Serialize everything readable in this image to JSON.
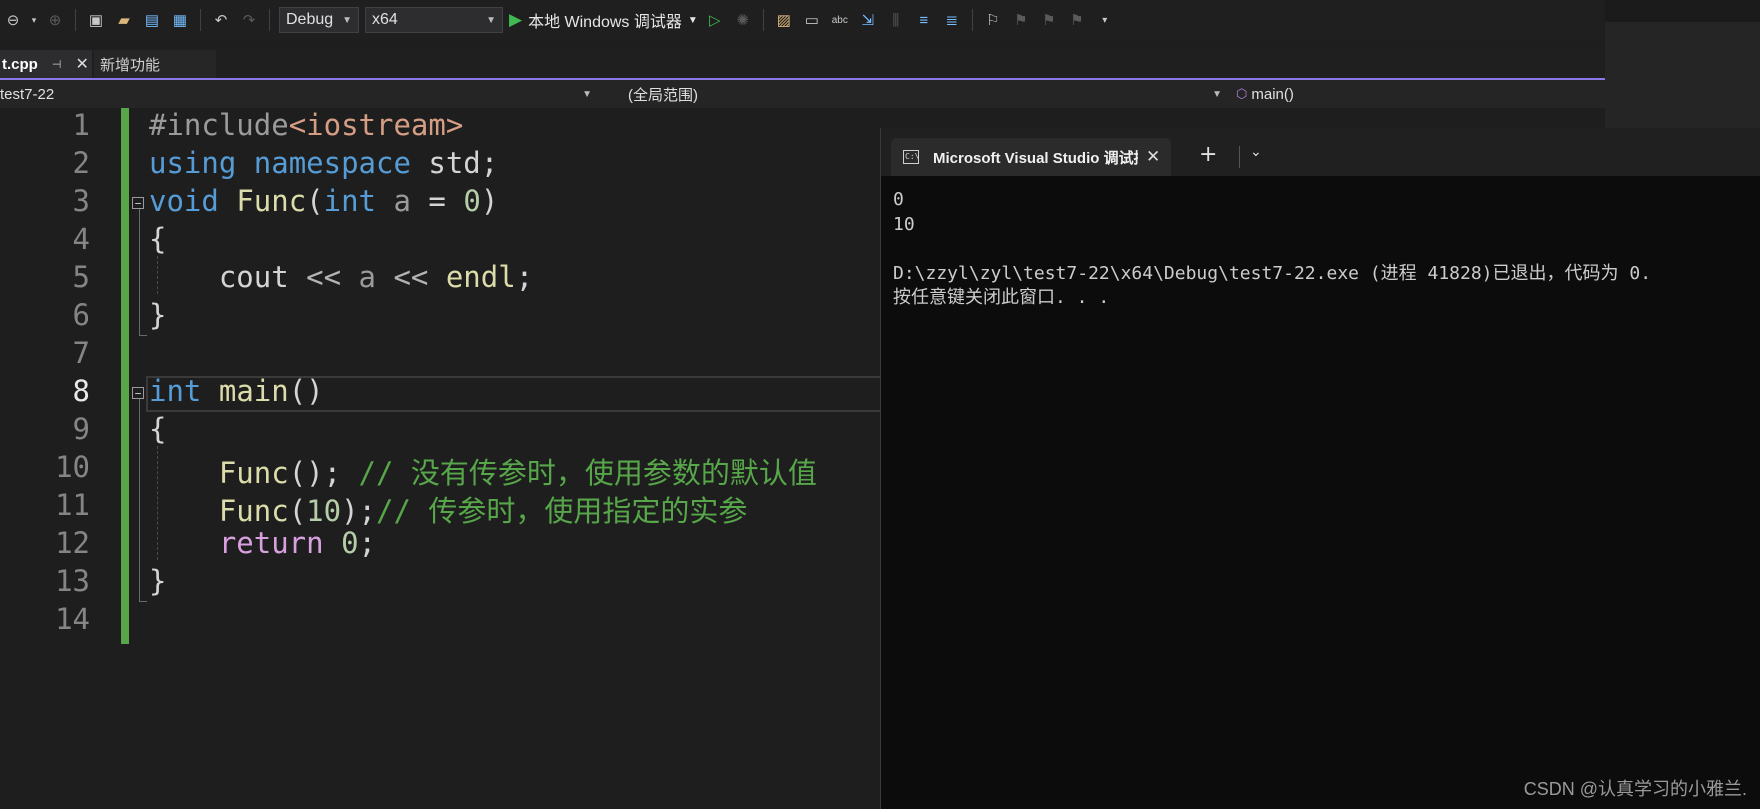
{
  "toolbar": {
    "config_select": "Debug",
    "platform_select": "x64",
    "run_label": "本地 Windows 调试器",
    "icons": [
      "back-icon",
      "forward-icon",
      "new-project-icon",
      "open-folder-icon",
      "save-icon",
      "save-all-icon",
      "undo-icon",
      "redo-icon",
      "run-without-debug-icon",
      "hot-reload-icon",
      "solution-explorer-icon",
      "layout-icon",
      "spell-check-icon",
      "step-icon",
      "comment-icon",
      "uncomment-icon",
      "bookmark-icon"
    ]
  },
  "tabs": [
    {
      "label": "t.cpp",
      "active": true
    },
    {
      "label": "新增功能",
      "active": false
    }
  ],
  "navbar": {
    "project": "test7-22",
    "scope": "(全局范围)",
    "member": "main()"
  },
  "editor": {
    "line_numbers": [
      "1",
      "2",
      "3",
      "4",
      "5",
      "6",
      "7",
      "8",
      "9",
      "10",
      "11",
      "12",
      "13",
      "14"
    ],
    "current_line": "8",
    "lines": {
      "l1": {
        "a": "#include",
        "b": "<iostream>"
      },
      "l2": {
        "a": "using",
        "b": "namespace",
        "c": "std;"
      },
      "l3": {
        "a": "void",
        "b": "Func",
        "c": "(",
        "d": "int",
        "e": "a",
        "f": " = ",
        "g": "0",
        "h": ")"
      },
      "l4": {
        "a": "{"
      },
      "l5": {
        "a": "cout",
        "b": " << ",
        "c": "a",
        "d": " << ",
        "e": "endl",
        "f": ";"
      },
      "l6": {
        "a": "}"
      },
      "l8": {
        "a": "int",
        "b": "main",
        "c": "()"
      },
      "l9": {
        "a": "{"
      },
      "l10": {
        "a": "Func",
        "b": "(); ",
        "c": "// 没有传参时，使用参数的默认值"
      },
      "l11": {
        "a": "Func",
        "b": "(",
        "c": "10",
        "d": ");",
        "e": "// 传参时，使用指定的实参"
      },
      "l12": {
        "a": "return",
        "b": "0",
        "c": ";"
      },
      "l13": {
        "a": "}"
      }
    }
  },
  "console": {
    "tab_title": "Microsoft Visual Studio 调试控制台",
    "output_lines": [
      "0",
      "10",
      "",
      "D:\\zzyl\\zyl\\test7-22\\x64\\Debug\\test7-22.exe (进程 41828)已退出，代码为 0.",
      "按任意键关闭此窗口. . ."
    ]
  },
  "watermark": "CSDN @认真学习的小雅兰."
}
